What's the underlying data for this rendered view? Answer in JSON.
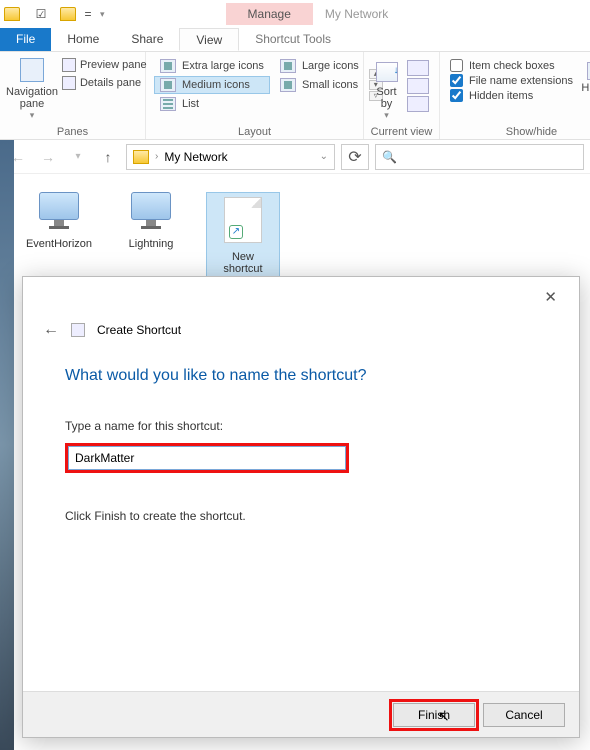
{
  "titlebar": {
    "manage_label": "Manage",
    "window_title": "My Network"
  },
  "tabs": {
    "file": "File",
    "home": "Home",
    "share": "Share",
    "view": "View",
    "shortcut_tools": "Shortcut Tools"
  },
  "ribbon": {
    "panes": {
      "navigation": "Navigation pane",
      "preview": "Preview pane",
      "details": "Details pane",
      "group": "Panes"
    },
    "layout": {
      "extra_large": "Extra large icons",
      "large": "Large icons",
      "medium": "Medium icons",
      "small": "Small icons",
      "list": "List",
      "group": "Layout"
    },
    "current_view": {
      "sort_by": "Sort by",
      "group": "Current view"
    },
    "show_hide": {
      "item_check": "Item check boxes",
      "file_ext": "File name extensions",
      "hidden": "Hidden items",
      "hide_sel": "Hide s",
      "group": "Show/hide"
    }
  },
  "address": {
    "location": "My Network"
  },
  "files": {
    "items": [
      {
        "name": "EventHorizon"
      },
      {
        "name": "Lightning"
      },
      {
        "name": "New shortcut"
      }
    ]
  },
  "dialog": {
    "title": "Create Shortcut",
    "heading": "What would you like to name the shortcut?",
    "field_label": "Type a name for this shortcut:",
    "input_value": "DarkMatter",
    "hint": "Click Finish to create the shortcut.",
    "finish": "Finish",
    "cancel": "Cancel"
  }
}
